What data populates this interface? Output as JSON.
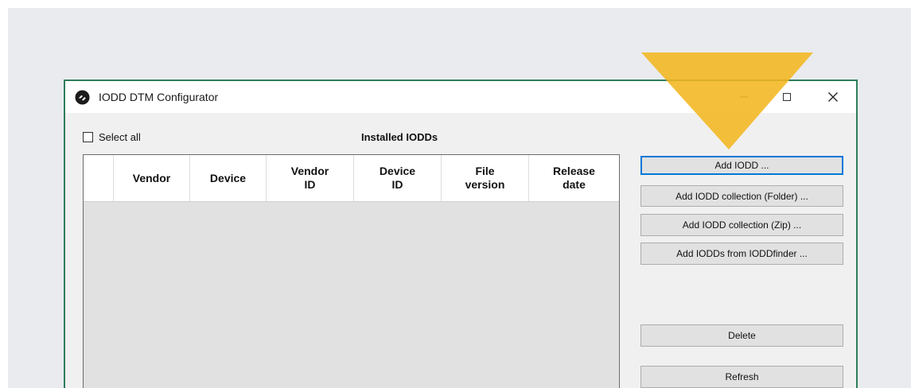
{
  "window": {
    "title": "IODD DTM Configurator"
  },
  "select_all": {
    "label": "Select all",
    "checked": false
  },
  "installed_label": "Installed IODDs",
  "table": {
    "columns": [
      {
        "label": "",
        "width": 38
      },
      {
        "label": "Vendor",
        "width": 96
      },
      {
        "label": "Device",
        "width": 96
      },
      {
        "label": "Vendor\nID",
        "width": 110
      },
      {
        "label": "Device\nID",
        "width": 110
      },
      {
        "label": "File\nversion",
        "width": 110
      },
      {
        "label": "Release\ndate",
        "width": 113
      }
    ],
    "rows": []
  },
  "buttons": {
    "add_iodd": "Add IODD ...",
    "add_collection_folder": "Add IODD collection (Folder) ...",
    "add_collection_zip": "Add IODD collection (Zip) ...",
    "add_from_finder": "Add IODDs from IODDfinder ...",
    "delete": "Delete",
    "refresh": "Refresh"
  },
  "colors": {
    "window_border": "#2e7d5b",
    "focus_border": "#0078d7",
    "pointer_arrow": "#f3b61f",
    "button_face": "#e1e1e1",
    "backdrop": "#e9ebee"
  },
  "icons": {
    "app": "app-logo-icon",
    "minimize": "minimize-icon",
    "maximize": "maximize-icon",
    "close": "close-icon",
    "pointer": "arrow-pointer-icon"
  }
}
